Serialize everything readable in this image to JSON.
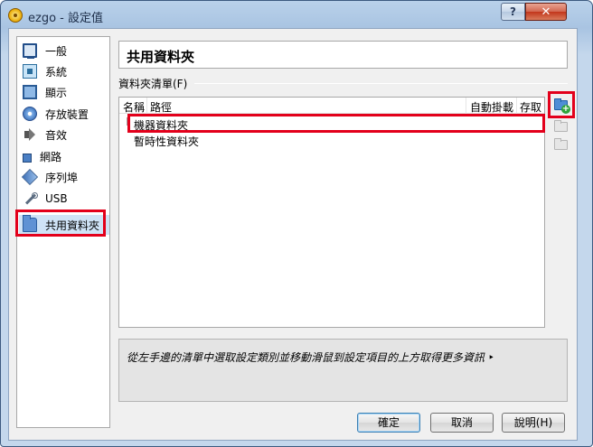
{
  "window": {
    "title": "ezgo - 設定值",
    "help_glyph": "?",
    "close_glyph": "✕"
  },
  "sidebar": {
    "items": [
      {
        "label": "一般",
        "icon": "monitor-icon"
      },
      {
        "label": "系統",
        "icon": "chip-icon"
      },
      {
        "label": "顯示",
        "icon": "display-icon"
      },
      {
        "label": "存放裝置",
        "icon": "disk-icon"
      },
      {
        "label": "音效",
        "icon": "audio-icon"
      },
      {
        "label": "網路",
        "icon": "network-icon"
      },
      {
        "label": "序列埠",
        "icon": "serial-port-icon"
      },
      {
        "label": "USB",
        "icon": "usb-icon"
      },
      {
        "label": "共用資料夾",
        "icon": "folder-icon",
        "selected": true
      }
    ]
  },
  "main": {
    "page_title": "共用資料夾",
    "section_label": "資料夾清單(F)",
    "columns": [
      "名稱",
      "路徑",
      "自動掛載",
      "存取"
    ],
    "rows": [
      "機器資料夾",
      "暫時性資料夾"
    ],
    "hint": "從左手邊的清單中選取設定類別並移動滑鼠到設定項目的上方取得更多資訊 ‣"
  },
  "buttons": {
    "ok": "確定",
    "cancel": "取消",
    "help": "說明(H)"
  },
  "tools": [
    "add-shared-folder-icon",
    "edit-shared-folder-icon",
    "remove-shared-folder-icon"
  ],
  "colors": {
    "highlight_red": "#e3001b",
    "selection": "#cfe3f6",
    "title_gradient_top": "#b9d1ea"
  }
}
